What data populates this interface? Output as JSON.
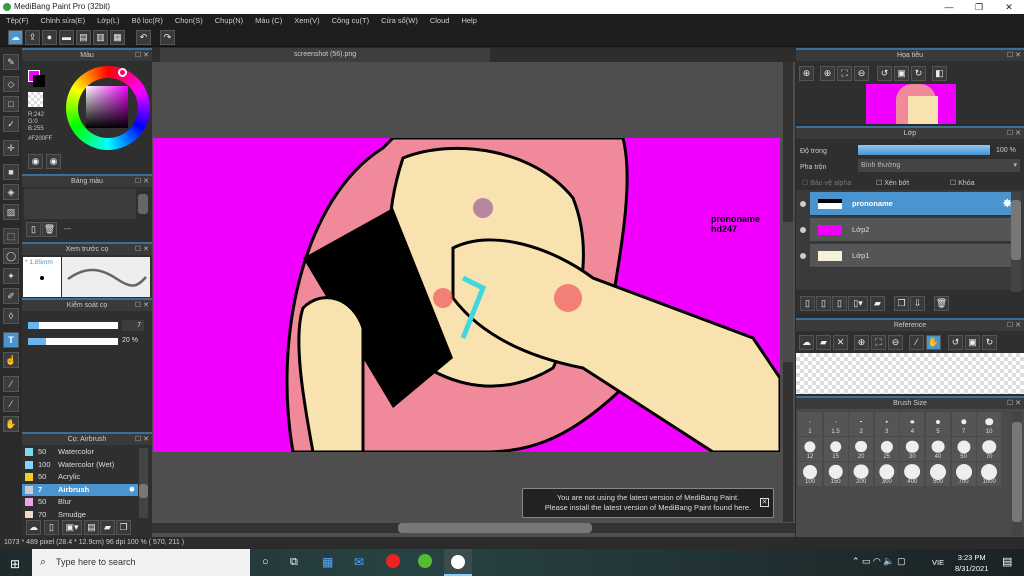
{
  "window": {
    "title": "MediBang Paint Pro (32bit)"
  },
  "menu": [
    "Tệp(F)",
    "Chỉnh sửa(E)",
    "Lớp(L)",
    "Bộ lọc(R)",
    "Chọn(S)",
    "Chụp(N)",
    "Màu (C)",
    "Xem(V)",
    "Công cụ(T)",
    "Cửa sổ(W)",
    "Cloud",
    "Help"
  ],
  "document_tab": "screenshot (56).png",
  "color_panel": {
    "title": "Màu",
    "r": "R:242",
    "g": "G:0",
    "b": "B:255",
    "hex": "#F200FF",
    "current_color": "#F200FF"
  },
  "palette_panel": {
    "title": "Bảng màu",
    "label": "---"
  },
  "brush_preview": {
    "title": "Xem trước cọ",
    "size": "* 1.85mm"
  },
  "brush_control": {
    "title": "Kiểm soát cọ",
    "size_value": "7",
    "opacity_value": "20 %",
    "size_fraction": 0.05,
    "opacity_fraction": 0.2
  },
  "brush_list": {
    "title": "Cọ: Airbrush",
    "items": [
      {
        "size": "50",
        "name": "Watercolor",
        "color": "#7fd8f5"
      },
      {
        "size": "100",
        "name": "Watercolor (Wet)",
        "color": "#7fd8f5"
      },
      {
        "size": "50",
        "name": "Acrylic",
        "color": "#f0d020"
      },
      {
        "size": "7",
        "name": "Airbrush",
        "color": "#cccccc",
        "selected": true
      },
      {
        "size": "50",
        "name": "Blur",
        "color": "#f59ff0"
      },
      {
        "size": "70",
        "name": "Smudge",
        "color": "#f5d8c0"
      }
    ]
  },
  "status": "1073 * 489 pixel  (28.4 * 12.9cm)  96 dpi  100 %  ( 570, 211 )",
  "notice": {
    "line1": "You are not using the latest version of MediBang Paint.",
    "line2": "Please install the latest version of MediBang Paint found here."
  },
  "navigator": {
    "title": "Họa tiêu"
  },
  "layer_panel": {
    "title": "Lớp",
    "opacity_label": "Độ trong",
    "opacity_value": "100 %",
    "opacity_fraction": 1.0,
    "blend_label": "Pha trộn",
    "blend_value": "Bình thường",
    "protect_alpha": "Bảo vệ alpha",
    "clipping": "Xén bớt",
    "lock": "Khóa",
    "layers": [
      {
        "name": "prononame",
        "selected": true
      },
      {
        "name": "Lớp2"
      },
      {
        "name": "Lớp1"
      }
    ]
  },
  "reference": {
    "title": "Reference"
  },
  "brush_size": {
    "title": "Brush Size",
    "sizes": [
      "1",
      "1.5",
      "2",
      "3",
      "4",
      "5",
      "7",
      "10",
      "12",
      "15",
      "20",
      "25",
      "30",
      "40",
      "50",
      "70",
      "100",
      "150",
      "200",
      "300",
      "400",
      "500",
      "700",
      "1000"
    ]
  },
  "watermark": {
    "line1": "prononame",
    "line2": "hd247"
  },
  "taskbar": {
    "search_placeholder": "Type here to search",
    "lang": "VIE",
    "time": "3:23 PM",
    "date": "8/31/2021"
  }
}
